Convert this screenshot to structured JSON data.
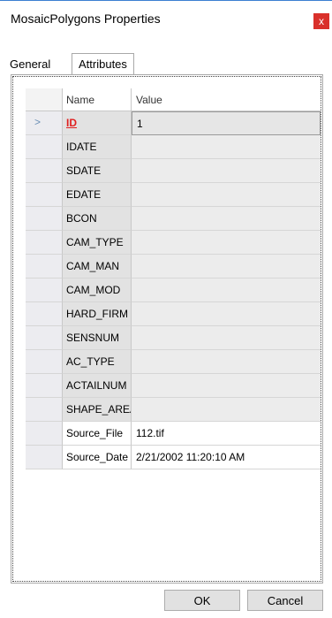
{
  "window": {
    "title": "MosaicPolygons Properties",
    "close_label": "x"
  },
  "tabs": [
    {
      "label": "General",
      "active": false
    },
    {
      "label": "Attributes",
      "active": true
    }
  ],
  "grid": {
    "columns": {
      "name": "Name",
      "value": "Value"
    },
    "current_row_indicator": ">",
    "rows": [
      {
        "name": "ID",
        "value": "1"
      },
      {
        "name": "IDATE",
        "value": ""
      },
      {
        "name": "SDATE",
        "value": ""
      },
      {
        "name": "EDATE",
        "value": ""
      },
      {
        "name": "BCON",
        "value": ""
      },
      {
        "name": "CAM_TYPE",
        "value": ""
      },
      {
        "name": "CAM_MAN",
        "value": ""
      },
      {
        "name": "CAM_MOD",
        "value": ""
      },
      {
        "name": "HARD_FIRM",
        "value": ""
      },
      {
        "name": "SENSNUM",
        "value": ""
      },
      {
        "name": "AC_TYPE",
        "value": ""
      },
      {
        "name": "ACTAILNUM",
        "value": ""
      },
      {
        "name": "SHAPE_AREA",
        "value": ""
      },
      {
        "name": "Source_File",
        "value": "112.tif"
      },
      {
        "name": "Source_Date",
        "value": "2/21/2002 11:20:10 AM"
      }
    ]
  },
  "buttons": {
    "ok": "OK",
    "cancel": "Cancel"
  }
}
